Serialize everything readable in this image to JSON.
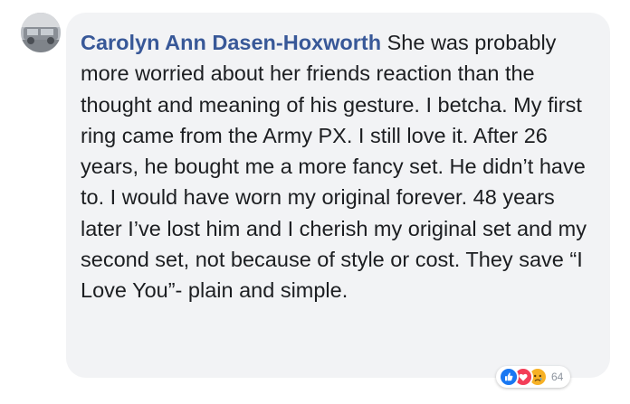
{
  "comment": {
    "author": "Carolyn Ann Dasen-Hoxworth",
    "text": " She was probably more worried about her friends reaction than the thought and meaning of his gesture. I betcha. My first ring came from the Army PX. I still love it. After 26 years, he bought me a more fancy set. He didn’t have to. I would have worn my original forever. 48 years later I’ve lost him and I cherish my original set and my second set, not because of style or cost. They save “I Love You”- plain and simple."
  },
  "reactions": {
    "icons": [
      "like-icon",
      "love-icon",
      "sad-icon"
    ],
    "count": "64"
  },
  "colors": {
    "author_name": "#385898",
    "bubble_background": "#f2f3f5",
    "text": "#1c1e21",
    "like": "#1877f2",
    "love": "#f33e58",
    "sad": "#f7b125"
  }
}
